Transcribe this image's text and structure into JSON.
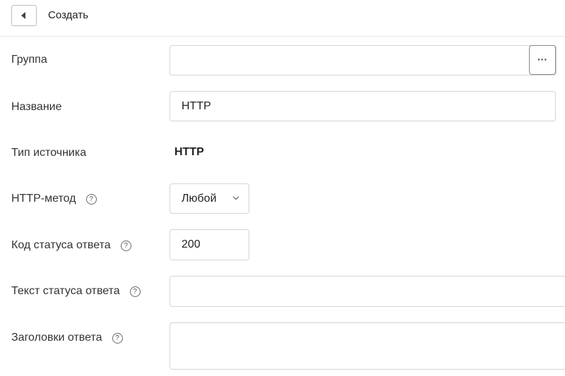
{
  "header": {
    "title": "Создать"
  },
  "form": {
    "group": {
      "label": "Группа",
      "value": "",
      "picker_label": "···"
    },
    "name": {
      "label": "Название",
      "value": "HTTP"
    },
    "source_type": {
      "label": "Тип источника",
      "value": "HTTP"
    },
    "http_method": {
      "label": "HTTP-метод",
      "value": "Любой"
    },
    "status_code": {
      "label": "Код статуса ответа",
      "value": "200"
    },
    "status_text": {
      "label": "Текст статуса ответа",
      "value": ""
    },
    "headers": {
      "label": "Заголовки ответа",
      "value": ""
    },
    "help_glyph": "?"
  }
}
